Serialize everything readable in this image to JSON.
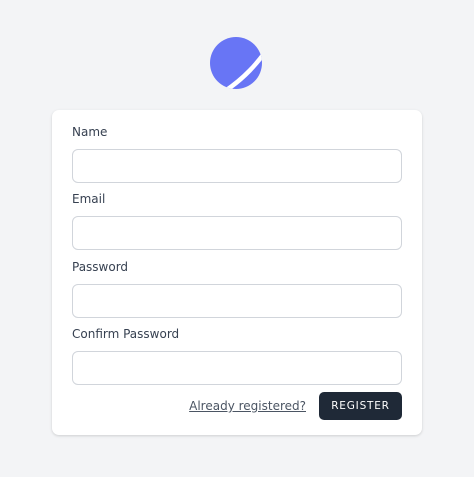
{
  "brand": {
    "logo_icon": "crescent-planet-logo-icon",
    "logo_color": "#6875f5"
  },
  "form": {
    "name_label": "Name",
    "email_label": "Email",
    "password_label": "Password",
    "confirm_password_label": "Confirm Password",
    "name_value": "",
    "email_value": "",
    "password_value": "",
    "confirm_password_value": ""
  },
  "actions": {
    "login_link": "Already registered?",
    "register_button": "REGISTER"
  },
  "colors": {
    "background": "#f3f4f6",
    "card": "#ffffff",
    "button": "#1f2937"
  }
}
